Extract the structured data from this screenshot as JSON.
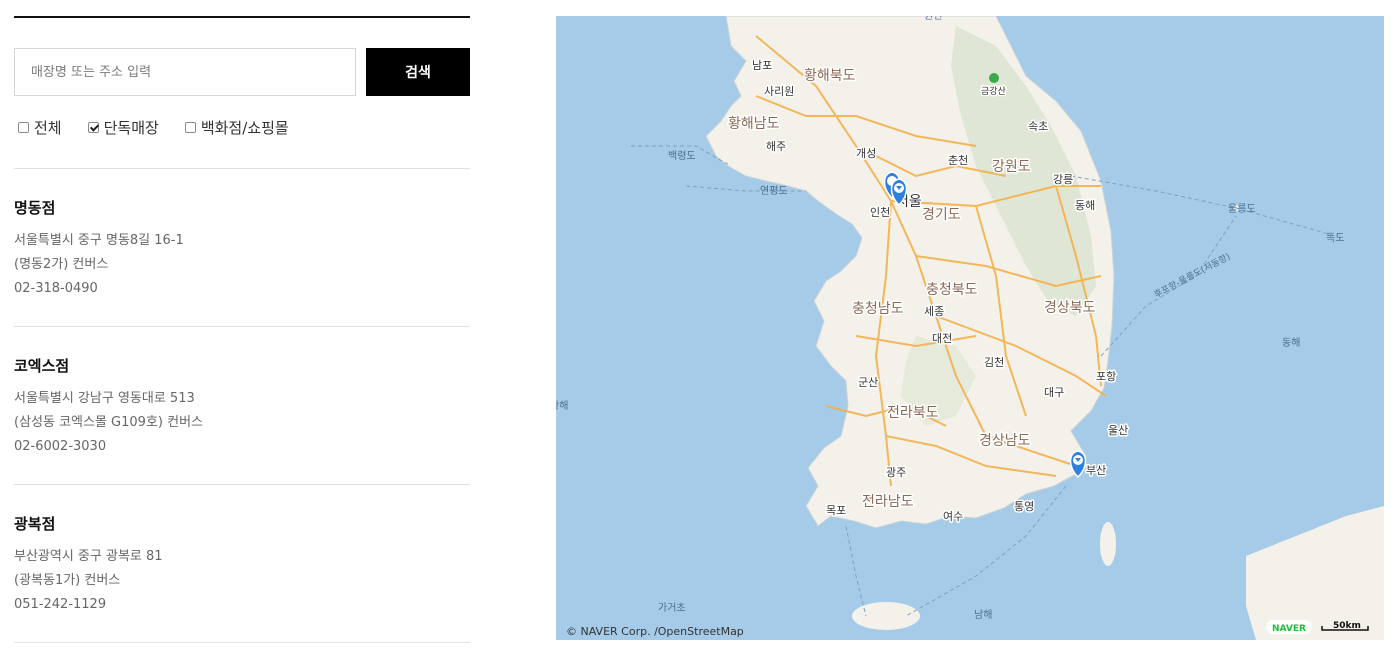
{
  "search": {
    "placeholder": "매장명 또는 주소 입력",
    "button_label": "검색"
  },
  "filters": [
    {
      "label": "전체",
      "checked": false
    },
    {
      "label": "단독매장",
      "checked": true
    },
    {
      "label": "백화점/쇼핑몰",
      "checked": false
    }
  ],
  "stores": [
    {
      "name": "명동점",
      "address": "서울특별시 중구 명동8길 16-1",
      "detail": "(명동2가) 컨버스",
      "phone": "02-318-0490"
    },
    {
      "name": "코엑스점",
      "address": "서울특별시 강남구 영동대로 513",
      "detail": "(삼성동 코엑스몰 G109호) 컨버스",
      "phone": "02-6002-3030"
    },
    {
      "name": "광복점",
      "address": "부산광역시 중구 광복로 81",
      "detail": "(광복동1가) 컨버스",
      "phone": "051-242-1129"
    }
  ],
  "map": {
    "provinces": [
      "황해북도",
      "황해남도",
      "강원도",
      "경기도",
      "충청북도",
      "충청남도",
      "경상북도",
      "전라북도",
      "경상남도",
      "전라남도"
    ],
    "cities": [
      "남포",
      "사리원",
      "해주",
      "개성",
      "춘천",
      "속초",
      "강릉",
      "동해",
      "서울",
      "인천",
      "세종",
      "대전",
      "김천",
      "포항",
      "대구",
      "울산",
      "부산",
      "광주",
      "목포",
      "여수",
      "통영",
      "군산",
      "금강산"
    ],
    "sea_labels": [
      "백령도",
      "연평도",
      "울릉도",
      "독도",
      "후포항-울릉도(저동항)",
      "동해",
      "남해",
      "가거초",
      "황해",
      "권현"
    ],
    "copyright": "© NAVER Corp. /OpenStreetMap",
    "brand": "NAVER",
    "scale_label": "50km",
    "colors": {
      "water": "#a5cbe8",
      "land": "#f3f1ea",
      "road": "#f4b04a",
      "marker": "#2f7fe0"
    }
  }
}
